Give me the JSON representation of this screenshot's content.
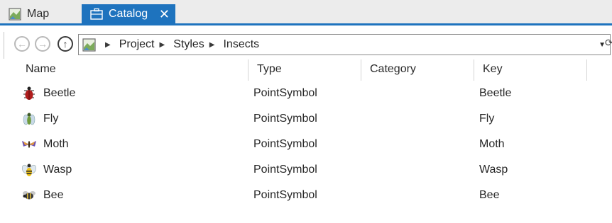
{
  "tabs": [
    {
      "label": "Map",
      "icon": "map-icon",
      "active": false
    },
    {
      "label": "Catalog",
      "icon": "catalog-icon",
      "active": true,
      "close": "✕"
    }
  ],
  "nav": {
    "back_icon": "back-arrow-icon",
    "forward_icon": "forward-arrow-icon",
    "up_icon": "up-arrow-icon",
    "path": [
      "Project",
      "Styles",
      "Insects"
    ],
    "separator": "▶",
    "dropdown": "▼"
  },
  "columns": [
    "Name",
    "Type",
    "Category",
    "Key"
  ],
  "rows": [
    {
      "name": "Beetle",
      "type": "PointSymbol",
      "category": "",
      "key": "Beetle",
      "icon": "beetle-icon"
    },
    {
      "name": "Fly",
      "type": "PointSymbol",
      "category": "",
      "key": "Fly",
      "icon": "fly-icon"
    },
    {
      "name": "Moth",
      "type": "PointSymbol",
      "category": "",
      "key": "Moth",
      "icon": "moth-icon"
    },
    {
      "name": "Wasp",
      "type": "PointSymbol",
      "category": "",
      "key": "Wasp",
      "icon": "wasp-icon"
    },
    {
      "name": "Bee",
      "type": "PointSymbol",
      "category": "",
      "key": "Bee",
      "icon": "bee-icon"
    }
  ],
  "colors": {
    "accent": "#1e73be",
    "tabstrip": "#ececec"
  }
}
